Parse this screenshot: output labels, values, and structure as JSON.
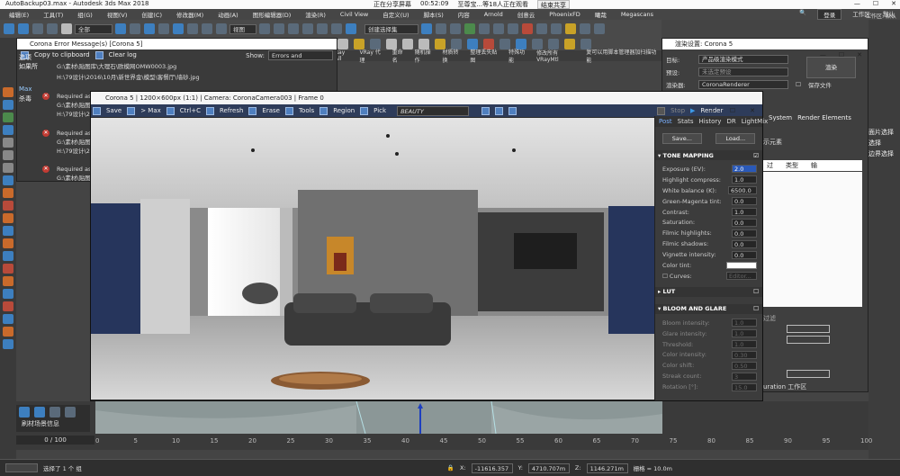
{
  "titlebar": {
    "title": "AutoBackup03.max - Autodesk 3ds Max 2018",
    "sharing": "正在分享屏幕",
    "timer": "00:52:09",
    "meeting": "至尊宝...等18人正在观看",
    "stop": "结束共享"
  },
  "menu": {
    "items": [
      "编辑(E)",
      "工具(T)",
      "组(G)",
      "视图(V)",
      "创建(C)",
      "修改器(M)",
      "动画(A)",
      "图形编辑器(D)",
      "渲染(R)",
      "Civil View",
      "自定义(U)",
      "脚本(S)",
      "内容",
      "Arnold",
      "创意云",
      "PhoenixFD",
      "曦哉",
      "Megascans"
    ],
    "login": "登录",
    "workspace": "工作区:",
    "default": "默认"
  },
  "toolbar": {
    "filter": "全部",
    "view": "视图",
    "selset": "创建选择集"
  },
  "toolbar3": [
    "Ray All",
    "VRay 代理",
    "重命名",
    "随机操作",
    "材质转换",
    "整理丢失贴图",
    "特殊功能",
    "修改所有VRayMtl",
    "复可以用脚本管理器加扫描功能"
  ],
  "errorwin": {
    "title": "Corona Error Message(s)    [Corona 5]",
    "copy": "Copy to clipboard",
    "clear": "Clear log",
    "show_label": "Show:",
    "show_value": "Errors and warnings",
    "lines": [
      "G:\\素材\\贴图库\\大理石\\欧模网OMW0003.jpg",
      "H:\\79设计\\2016\\10月\\新世界金\\模型\\客餐厅\\墙砂.jpg",
      "Required as",
      "G:\\素材\\贴图库",
      "H:\\79设计\\2",
      "Required as",
      "G:\\素材\\贴图库",
      "H:\\79设计\\2",
      "Required as",
      "G:\\素材\\贴图库",
      "H:\\79设计\\2"
    ]
  },
  "leftlabels": [
    "选项",
    "如果所",
    "Max",
    "杀毒"
  ],
  "vfb": {
    "title": "Corona 5 | 1200×600px (1:1) | Camera: CoronaCamera003 | Frame 0",
    "buttons": [
      "Save",
      "> Max",
      "Ctrl+C",
      "Refresh",
      "Erase",
      "Tools",
      "Region",
      "Pick"
    ],
    "beauty": "BEAUTY",
    "stop": "Stop",
    "render": "Render"
  },
  "post": {
    "tabs": [
      "Post",
      "Stats",
      "History",
      "DR",
      "LightMix"
    ],
    "save": "Save...",
    "load": "Load...",
    "tone_title": "TONE MAPPING",
    "tone": [
      {
        "label": "Exposure (EV):",
        "value": "2.0"
      },
      {
        "label": "Highlight compress:",
        "value": "1.0"
      },
      {
        "label": "White balance (K):",
        "value": "6500.0"
      },
      {
        "label": "Green-Magenta tint:",
        "value": "0.0"
      },
      {
        "label": "Contrast:",
        "value": "1.0"
      },
      {
        "label": "Saturation:",
        "value": "0.0"
      },
      {
        "label": "Filmic highlights:",
        "value": "0.0"
      },
      {
        "label": "Filmic shadows:",
        "value": "0.0"
      },
      {
        "label": "Vignette intensity:",
        "value": "0.0"
      }
    ],
    "color_tint": "Color tint:",
    "curves": "Curves:",
    "editor": "Editor...",
    "lut_title": "LUT",
    "bloom_title": "BLOOM AND GLARE",
    "bloom": [
      {
        "label": "Bloom intensity:",
        "value": "1.0"
      },
      {
        "label": "Glare intensity:",
        "value": "1.0"
      },
      {
        "label": "Threshold:",
        "value": "1.0"
      },
      {
        "label": "Color intensity:",
        "value": "0.30"
      },
      {
        "label": "Color shift:",
        "value": "0.50"
      },
      {
        "label": "Streak count:",
        "value": "3"
      },
      {
        "label": "Rotation [°]:",
        "value": "15.0"
      }
    ]
  },
  "rsdlg": {
    "title": "渲染设置: Corona 5",
    "target_label": "目标:",
    "target": "产品级渲染模式",
    "preset_label": "预设:",
    "preset": "未选定预设",
    "renderer_label": "渲染器:",
    "renderer": "CoronaRenderer",
    "render_btn": "渲染",
    "save_file": "保存文件",
    "tabs": [
      "System",
      "Render Elements"
    ],
    "elements": "示元素",
    "col1": "过",
    "col2": "类型",
    "col3": "输",
    "misc1": "过滤",
    "misc2": "uration 工作区"
  },
  "rightedge": [
    "工作区: 默认",
    "面片选择",
    "选择",
    "边界选择"
  ],
  "timeline": {
    "frame": "0 / 100",
    "ticks": [
      "0",
      "5",
      "10",
      "15",
      "20",
      "25",
      "30",
      "35",
      "40",
      "45",
      "50",
      "55",
      "60",
      "65",
      "70",
      "75",
      "80",
      "85",
      "90",
      "95",
      "100"
    ],
    "info": "刷材场景信息"
  },
  "status": {
    "selected": "选择了 1 个 组",
    "x": "-11616.357",
    "y": "4710.707m",
    "z": "1146.271m",
    "grid": "栅格 = 10.0m"
  }
}
